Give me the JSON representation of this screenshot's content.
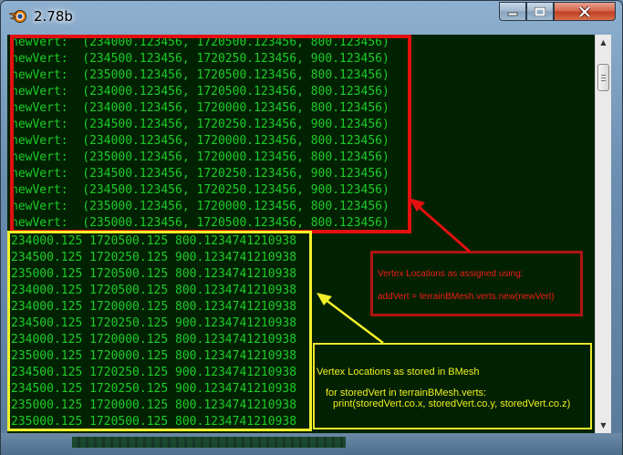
{
  "window": {
    "title": "2.78b",
    "icon": "blender-logo-icon"
  },
  "controls": {
    "minimize_icon": "minimize-icon",
    "maximize_icon": "maximize-icon",
    "close_icon": "close-icon"
  },
  "console": {
    "assigned_lines": [
      "newVert:  (234000.123456, 1720500.123456, 800.123456)",
      "newVert:  (234500.123456, 1720250.123456, 900.123456)",
      "newVert:  (235000.123456, 1720500.123456, 800.123456)",
      "newVert:  (234000.123456, 1720500.123456, 800.123456)",
      "newVert:  (234000.123456, 1720000.123456, 800.123456)",
      "newVert:  (234500.123456, 1720250.123456, 900.123456)",
      "newVert:  (234000.123456, 1720000.123456, 800.123456)",
      "newVert:  (235000.123456, 1720000.123456, 800.123456)",
      "newVert:  (234500.123456, 1720250.123456, 900.123456)",
      "newVert:  (234500.123456, 1720250.123456, 900.123456)",
      "newVert:  (235000.123456, 1720000.123456, 800.123456)",
      "newVert:  (235000.123456, 1720500.123456, 800.123456)"
    ],
    "stored_lines": [
      "234000.125 1720500.125 800.1234741210938",
      "234500.125 1720250.125 900.1234741210938",
      "235000.125 1720500.125 800.1234741210938",
      "234000.125 1720500.125 800.1234741210938",
      "234000.125 1720000.125 800.1234741210938",
      "234500.125 1720250.125 900.1234741210938",
      "234000.125 1720000.125 800.1234741210938",
      "235000.125 1720000.125 800.1234741210938",
      "234500.125 1720250.125 900.1234741210938",
      "234500.125 1720250.125 900.1234741210938",
      "235000.125 1720000.125 800.1234741210938",
      "235000.125 1720500.125 800.1234741210938"
    ]
  },
  "annotations": {
    "assigned": {
      "heading": "Vertex Locations as assigned using:",
      "code": "addVert = terrainBMesh.verts.new(newVert)",
      "color": "#e31010"
    },
    "stored": {
      "heading": "Vertex Locations as stored in BMesh",
      "code_line1": "for storedVert in terrainBMesh.verts:",
      "code_line2": "print(storedVert.co.x, storedVert.co.y, storedVert.co.z)",
      "color": "#f2f02a"
    }
  },
  "scrollbar": {
    "up_icon": "scroll-up-arrow-icon",
    "down_icon": "scroll-down-arrow-icon"
  },
  "colors": {
    "console_bg": "#002200",
    "console_text": "#1ecb2a"
  }
}
